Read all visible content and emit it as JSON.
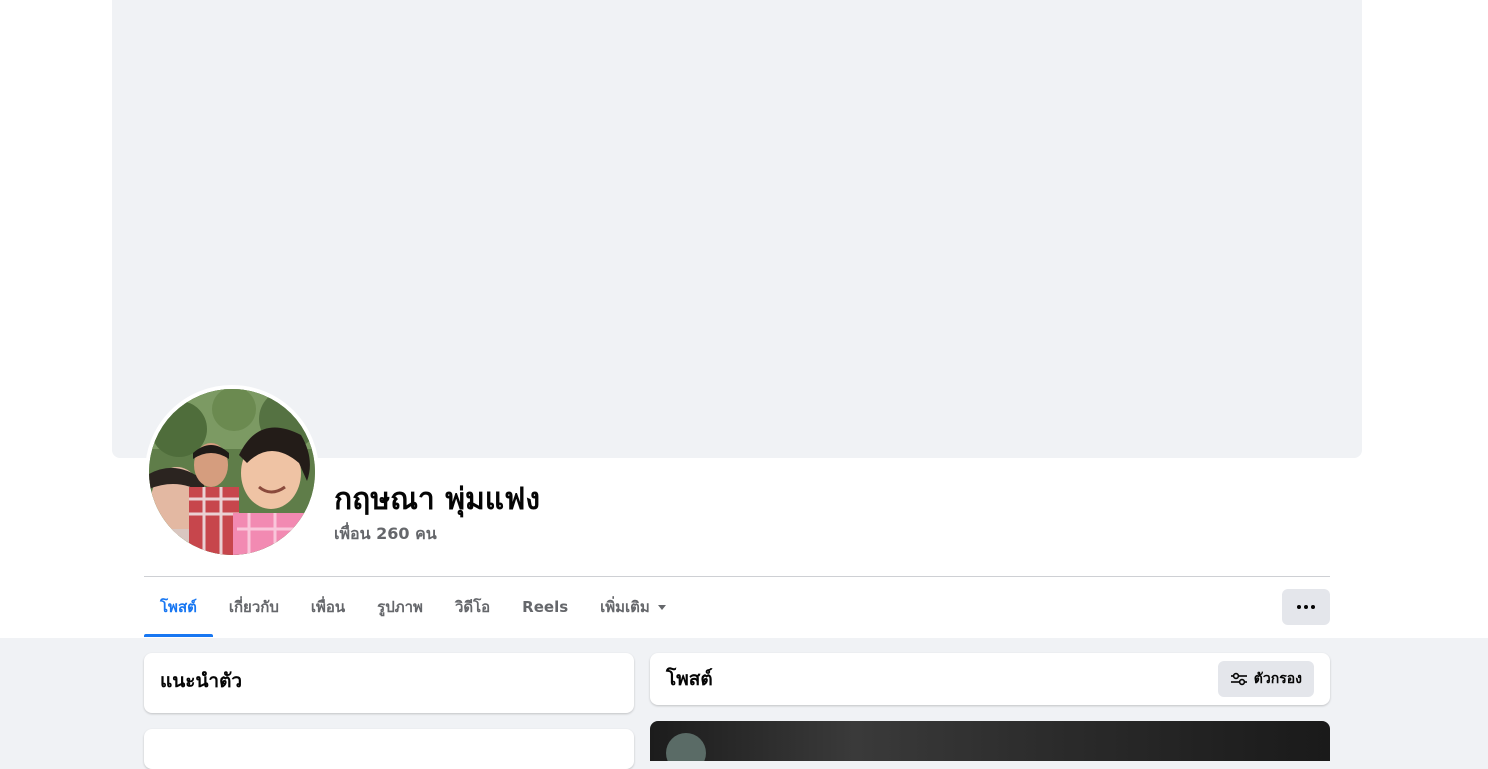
{
  "profile": {
    "name": "กฤษณา พุ่มแฟง",
    "friends_count": "เพื่อน 260 คน"
  },
  "tabs": [
    {
      "label": "โพสต์",
      "active": true
    },
    {
      "label": "เกี่ยวกับ",
      "active": false
    },
    {
      "label": "เพื่อน",
      "active": false
    },
    {
      "label": "รูปภาพ",
      "active": false
    },
    {
      "label": "วิดีโอ",
      "active": false
    },
    {
      "label": "Reels",
      "active": false
    },
    {
      "label": "เพิ่มเติม",
      "active": false
    }
  ],
  "intro": {
    "title": "แนะนำตัว"
  },
  "posts": {
    "title": "โพสต์",
    "filter_label": "ตัวกรอง"
  },
  "icons": {
    "more": "more-horizontal-icon",
    "filter": "sliders-icon",
    "dropdown": "chevron-down-icon"
  },
  "colors": {
    "accent": "#1877f2",
    "background": "#f0f2f5",
    "muted_text": "#65676b",
    "button_bg": "#e4e6eb"
  }
}
